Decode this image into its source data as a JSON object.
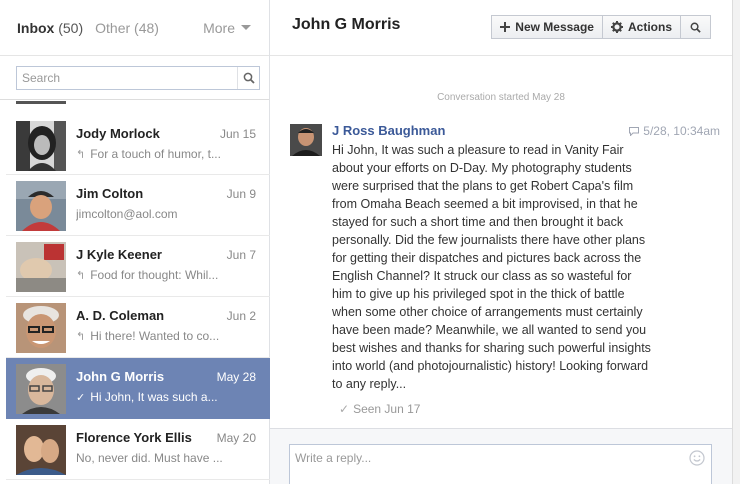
{
  "sidebar": {
    "tabs": {
      "inbox_label": "Inbox",
      "inbox_count": "(50)",
      "other_label": "Other (48)",
      "more_label": "More"
    },
    "search": {
      "placeholder": "Search"
    },
    "threads": [
      {
        "name": "Jody Morlock",
        "date": "Jun 15",
        "snippet": "For a touch of humor, t...",
        "glyph": "↰",
        "selected": false
      },
      {
        "name": "Jim Colton",
        "date": "Jun 9",
        "snippet": "jimcolton@aol.com",
        "glyph": "",
        "selected": false
      },
      {
        "name": "J Kyle Keener",
        "date": "Jun 7",
        "snippet": "Food for thought: Whil...",
        "glyph": "↰",
        "selected": false
      },
      {
        "name": "A. D. Coleman",
        "date": "Jun 2",
        "snippet": "Hi there! Wanted to co...",
        "glyph": "↰",
        "selected": false
      },
      {
        "name": "John G Morris",
        "date": "May 28",
        "snippet": "Hi John, It was such a...",
        "glyph": "✓",
        "selected": true
      },
      {
        "name": "Florence York Ellis",
        "date": "May 20",
        "snippet": "No, never did. Must have ...",
        "glyph": "",
        "selected": false
      }
    ]
  },
  "conversation": {
    "title": "John G Morris",
    "toolbar": {
      "new_message_label": "New Message",
      "actions_label": "Actions"
    },
    "started_text": "Conversation started May 28",
    "message": {
      "author": "J Ross Baughman",
      "time": "5/28, 10:34am",
      "body_lines": [
        "Hi John,  It was such a pleasure to read in Vanity Fair",
        "about your efforts on D-Day.  My photography students",
        "were surprised that the plans to get Robert Capa's film",
        "from Omaha Beach seemed a bit improvised, in that he",
        "stayed for such a short time and then brought it back",
        "personally.  Did the few journalists there have other plans",
        "for getting their dispatches and pictures back across the",
        "English Channel?  It struck our class as so wasteful for",
        "him to give up his privileged spot in the thick of battle",
        "when some other choice of arrangements must certainly",
        "have been made?  Meanwhile, we all wanted to send you",
        "best wishes and thanks for sharing such powerful insights",
        "into world (and photojournalistic) history!  Looking forward",
        "to any reply..."
      ]
    },
    "seen_text": "Seen Jun 17",
    "reply": {
      "placeholder": "Write a reply..."
    }
  },
  "icons": {
    "search": "magnifier-icon",
    "new_message": "plus-icon",
    "actions": "gear-icon",
    "reply": "reply-arrow-icon",
    "seen": "checkmark-icon",
    "emoji": "smiley-icon"
  },
  "colors": {
    "selected_row": "#6d84b4",
    "author_link": "#3b5998",
    "muted_text": "#888888"
  }
}
